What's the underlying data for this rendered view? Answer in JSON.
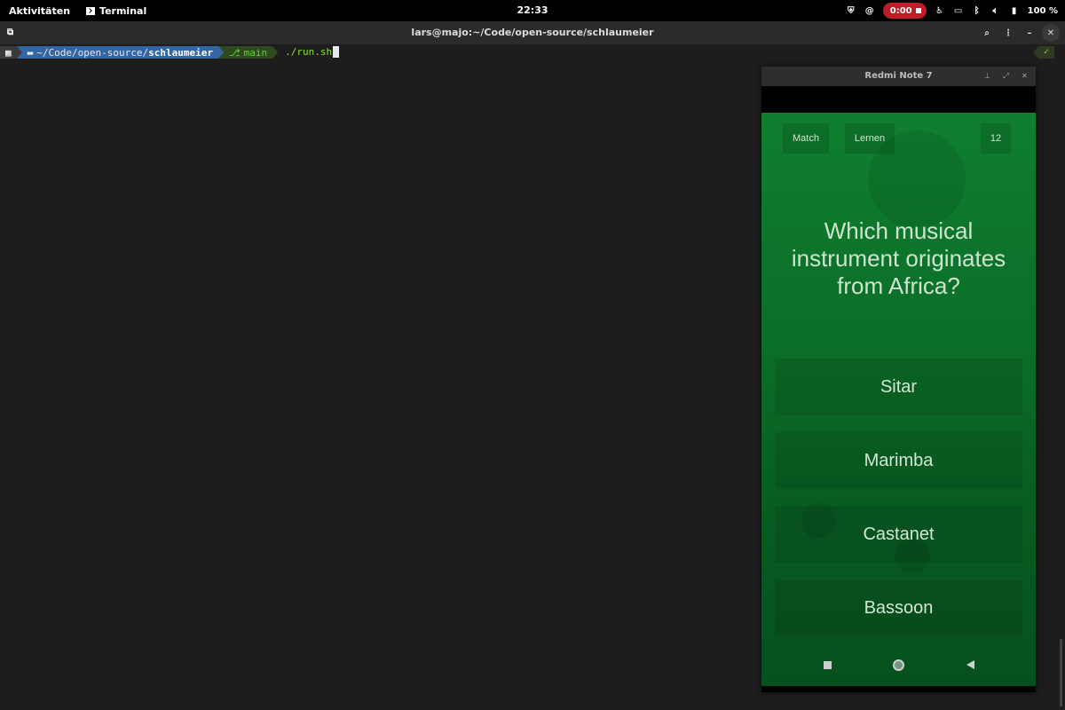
{
  "topbar": {
    "activities": "Aktivitäten",
    "app_name": "Terminal",
    "clock": "22:33",
    "recording_time": "0:00",
    "battery": "100 %"
  },
  "terminal": {
    "window_title": "lars@majo:~/Code/open-source/schlaumeier",
    "prompt": {
      "os_icon": "linux-icon",
      "dir_prefix": "~/Code/open-source/",
      "dir_current": "schlaumeier",
      "git_branch": "main",
      "command": "./run.sh",
      "status_ok": "✓"
    }
  },
  "emulator": {
    "title": "Redmi Note 7",
    "app": {
      "match_button": "Match",
      "learn_button": "Lernen",
      "score": "12",
      "question": "Which musical instrument originates from Africa?",
      "answers": [
        "Sitar",
        "Marimba",
        "Castanet",
        "Bassoon"
      ]
    }
  },
  "colors": {
    "screen_green": "#0b6e28",
    "record_red": "#c01c28",
    "dir_blue": "#3465a4",
    "git_green": "#5bd336"
  }
}
